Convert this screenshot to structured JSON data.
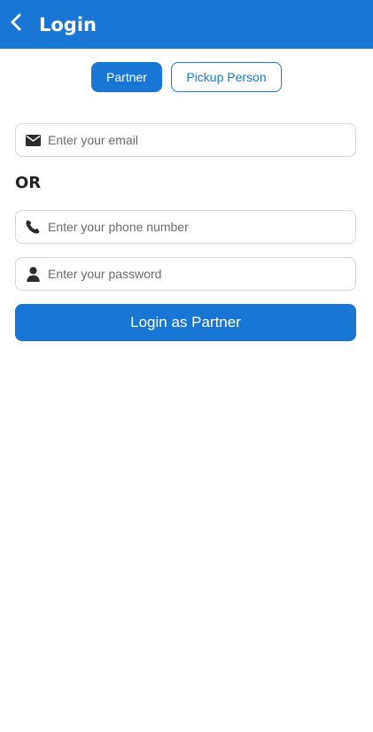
{
  "header": {
    "title": "Login",
    "back_icon": "chevron-left-icon",
    "color": "#1976d2"
  },
  "tabs": [
    {
      "label": "Partner",
      "active": true
    },
    {
      "label": "Pickup Person",
      "active": false
    }
  ],
  "form": {
    "email": {
      "placeholder": "Enter your email",
      "value": "",
      "icon": "envelope-icon"
    },
    "separator": "OR",
    "phone": {
      "placeholder": "Enter your phone number",
      "value": "",
      "icon": "phone-icon"
    },
    "password": {
      "placeholder": "Enter your password",
      "value": "",
      "icon": "user-icon"
    },
    "submit_label": "Login as Partner"
  }
}
